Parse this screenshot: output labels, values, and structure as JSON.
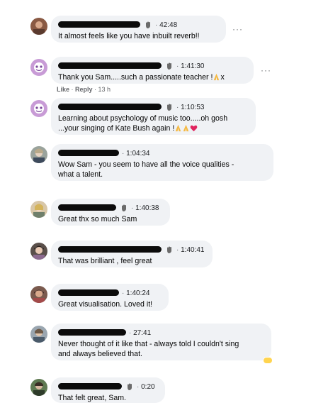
{
  "comments": [
    {
      "timestamp": "42:48",
      "text": "It almost feels like you have inbuilt reverb!!",
      "more": "···"
    },
    {
      "timestamp": "1:41:30",
      "text": "Thank you Sam.....such a passionate teacher !",
      "text_suffix": "x",
      "more": "···",
      "actions": {
        "like": "Like",
        "reply": "Reply",
        "age": "13 h"
      }
    },
    {
      "timestamp": "1:10:53",
      "text": "Learning about psychology of music too.....oh gosh\n...your singing of Kate Bush again !"
    },
    {
      "timestamp": "1:04:34",
      "text": "Wow Sam - you seem to have all the voice qualities -\nwhat a talent."
    },
    {
      "timestamp": "1:40:38",
      "text": "Great thx so much Sam"
    },
    {
      "timestamp": "1:40:41",
      "text": "That was brilliant , feel great"
    },
    {
      "timestamp": "1:40:24",
      "text": "Great visualisation. Loved it!"
    },
    {
      "timestamp": "27:41",
      "text": "Never thought of it like that - always told I couldn't sing\nand always believed that."
    },
    {
      "timestamp": "0:20",
      "text": "That felt great, Sam."
    }
  ],
  "icons": {
    "wave": "waving-hand-icon",
    "pray": "praying-hands-icon",
    "heart": "red-heart-icon"
  },
  "colors": {
    "bubble": "#f0f2f5",
    "text": "#050505",
    "muted": "#65676b",
    "heart": "#e0245e"
  }
}
